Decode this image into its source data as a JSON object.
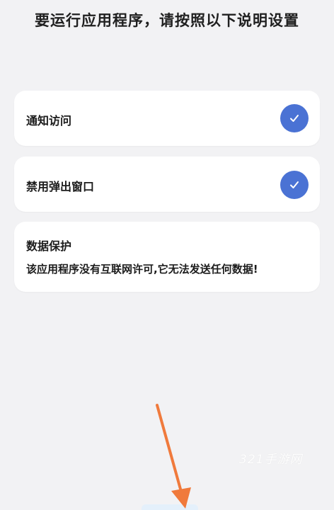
{
  "header": {
    "title": "要运行应用程序，请按照以下说明设置"
  },
  "settings": [
    {
      "label": "通知访问",
      "checked": true,
      "icon": "checkmark-icon"
    },
    {
      "label": "禁用弹出窗口",
      "checked": true,
      "icon": "checkmark-icon"
    }
  ],
  "info": {
    "title": "数据保护",
    "body": "该应用程序没有互联网许可,它无法发送任何数据!"
  },
  "watermark": {
    "text": "321手游网"
  },
  "colors": {
    "background": "#f2f2f4",
    "card": "#ffffff",
    "accent": "#4a72d4",
    "arrow": "#f07a3c"
  }
}
